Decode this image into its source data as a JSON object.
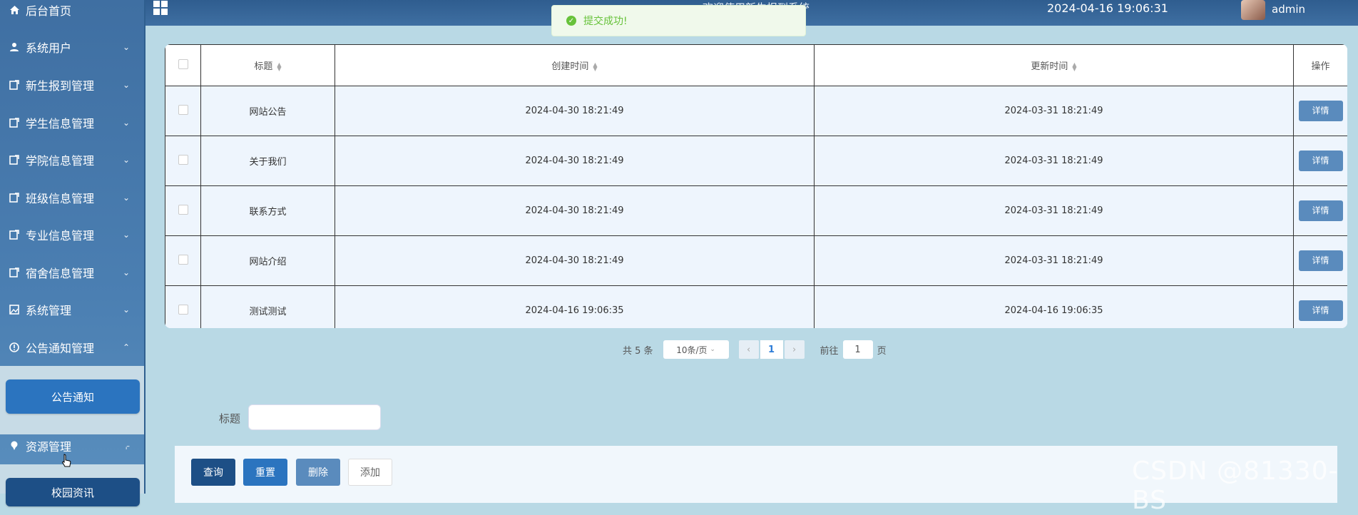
{
  "sidebar": {
    "items": [
      {
        "label": "后台首页",
        "icon": "home-icon"
      },
      {
        "label": "系统用户",
        "icon": "user-icon"
      },
      {
        "label": "新生报到管理",
        "icon": "edit-icon"
      },
      {
        "label": "学生信息管理",
        "icon": "edit-icon"
      },
      {
        "label": "学院信息管理",
        "icon": "edit-icon"
      },
      {
        "label": "班级信息管理",
        "icon": "edit-icon"
      },
      {
        "label": "专业信息管理",
        "icon": "edit-icon"
      },
      {
        "label": "宿舍信息管理",
        "icon": "edit-icon"
      },
      {
        "label": "系统管理",
        "icon": "image-icon"
      },
      {
        "label": "公告通知管理",
        "icon": "info-icon"
      },
      {
        "label": "资源管理",
        "icon": "pin-icon"
      }
    ],
    "sub_notice": "公告通知",
    "sub_resource": "校园资讯"
  },
  "header": {
    "title": "欢迎使用新生报到系统",
    "datetime": "2024-04-16 19:06:31",
    "username": "admin"
  },
  "toast": {
    "message": "提交成功!"
  },
  "table": {
    "headers": [
      "标题",
      "创建时间",
      "更新时间",
      "操作"
    ],
    "rows": [
      {
        "title": "网站公告",
        "created": "2024-04-30 18:21:49",
        "updated": "2024-03-31 18:21:49",
        "action": "详情"
      },
      {
        "title": "关于我们",
        "created": "2024-04-30 18:21:49",
        "updated": "2024-03-31 18:21:49",
        "action": "详情"
      },
      {
        "title": "联系方式",
        "created": "2024-04-30 18:21:49",
        "updated": "2024-03-31 18:21:49",
        "action": "详情"
      },
      {
        "title": "网站介绍",
        "created": "2024-04-30 18:21:49",
        "updated": "2024-03-31 18:21:49",
        "action": "详情"
      },
      {
        "title": "测试测试",
        "created": "2024-04-16 19:06:35",
        "updated": "2024-04-16 19:06:35",
        "action": "详情"
      }
    ]
  },
  "pagination": {
    "total": "共 5 条",
    "page_size": "10条/页",
    "current": "1",
    "goto_label": "前往",
    "goto_value": "1",
    "page_suffix": "页"
  },
  "search": {
    "label": "标题",
    "value": ""
  },
  "buttons": {
    "query": "查询",
    "reset": "重置",
    "delete": "删除",
    "add": "添加"
  },
  "watermark": "CSDN @81330-BS",
  "colors": {
    "primary": "#1d4f86",
    "accent": "#2b74bf",
    "success": "#67c23a"
  }
}
